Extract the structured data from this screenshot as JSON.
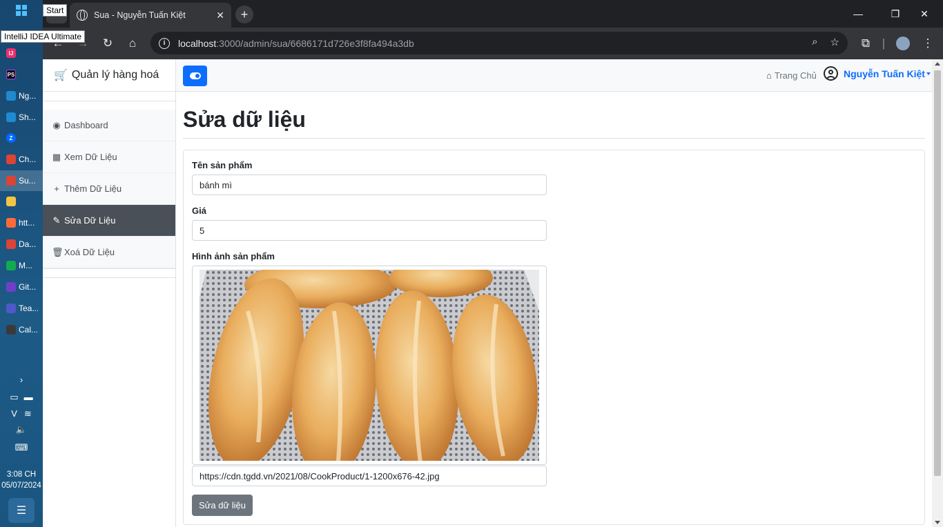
{
  "os": {
    "tooltip_start": "Start",
    "tooltip_idea": "IntelliJ IDEA Ultimate",
    "taskbar_items": [
      {
        "label": "Ng...",
        "icon": "webstorm-icon",
        "color": "#1f8ad2"
      },
      {
        "label": "Sh...",
        "icon": "webstorm-icon",
        "color": "#1f8ad2"
      },
      {
        "label": "Ch...",
        "icon": "chrome-icon",
        "color": "#db4437"
      },
      {
        "label": "Su...",
        "icon": "chrome-icon",
        "color": "#db4437"
      },
      {
        "label": "htt...",
        "icon": "postman-icon",
        "color": "#ff6c37"
      },
      {
        "label": "Da...",
        "icon": "chrome-icon",
        "color": "#db4437"
      },
      {
        "label": "M...",
        "icon": "mongodb-icon",
        "color": "#13aa52"
      },
      {
        "label": "Git...",
        "icon": "github-icon",
        "color": "#6e40c9"
      },
      {
        "label": "Tea...",
        "icon": "teams-icon",
        "color": "#5059c9"
      },
      {
        "label": "Cal...",
        "icon": "calculator-icon",
        "color": "#3a3a3a"
      }
    ],
    "clock_time": "3:08 CH",
    "clock_date": "05/07/2024"
  },
  "browser": {
    "tab_title": "Sua - Nguyễn Tuấn Kiệt",
    "url_host": "localhost",
    "url_path": ":3000/admin/sua/6686171d726e3f8fa494a3db"
  },
  "sidebar": {
    "brand": "Quản lý hàng hoá",
    "items": [
      {
        "label": "Dashboard",
        "icon": "dashboard-icon",
        "glyph": "◉"
      },
      {
        "label": "Xem Dữ Liệu",
        "icon": "table-icon",
        "glyph": "▦"
      },
      {
        "label": "Thêm Dữ Liệu",
        "icon": "plus-icon",
        "glyph": "+"
      },
      {
        "label": "Sửa Dữ Liệu",
        "icon": "pencil-icon",
        "glyph": "✎"
      },
      {
        "label": "Xoá Dữ Liệu",
        "icon": "trash-icon",
        "glyph": "🗑"
      }
    ],
    "active_index": 3
  },
  "topnav": {
    "home_label": "Trang Chủ",
    "user_name": "Nguyễn Tuấn Kiệt"
  },
  "form": {
    "title": "Sửa dữ liệu",
    "name_label": "Tên sản phẩm",
    "name_value": "bánh mì",
    "price_label": "Giá",
    "price_value": "5",
    "image_label": "Hình ảnh sản phẩm",
    "image_url": "https://cdn.tgdd.vn/2021/08/CookProduct/1-1200x676-42.jpg",
    "submit_label": "Sửa dữ liệu"
  },
  "colors": {
    "primary": "#0d6efd",
    "sidebar_active": "#495057",
    "button_secondary": "#6c757d"
  }
}
